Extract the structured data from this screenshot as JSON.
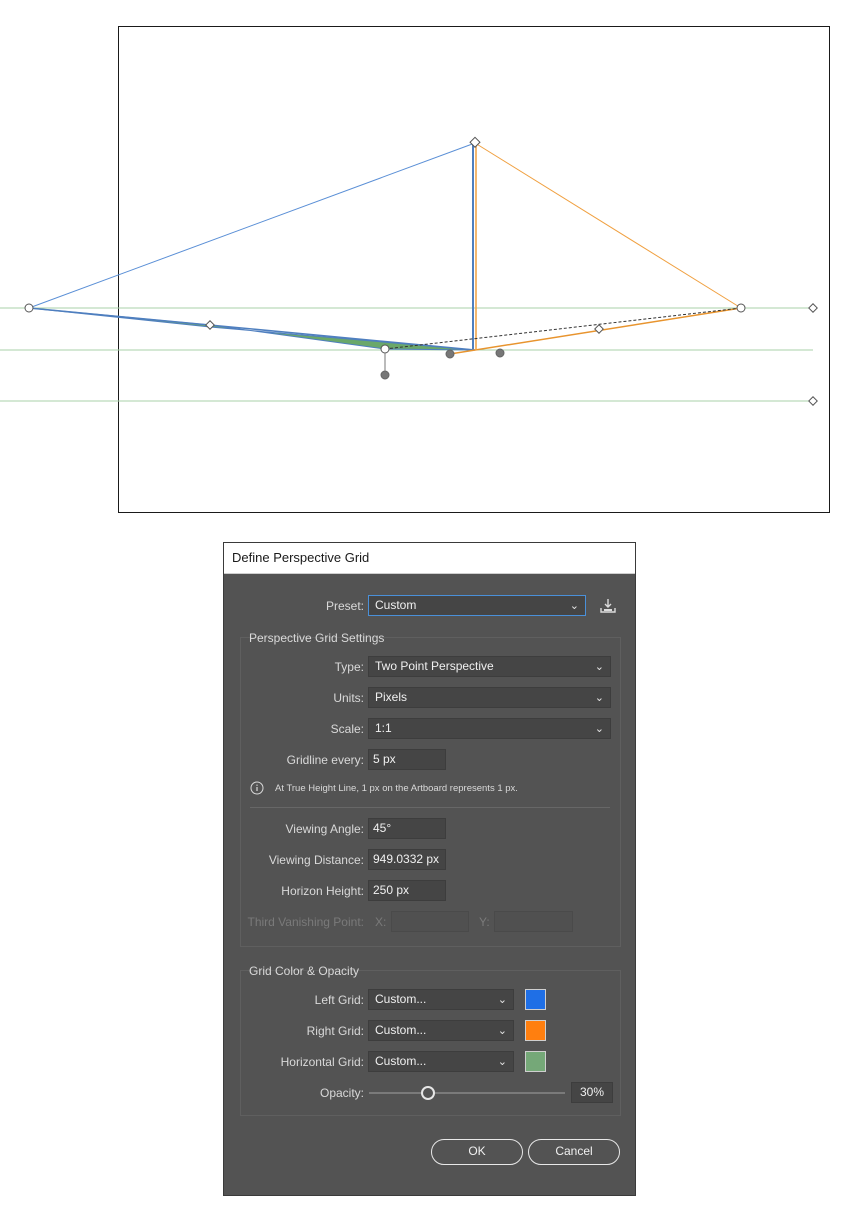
{
  "canvas": {
    "colors": {
      "left": "#5a8fd6",
      "right": "#f0a040",
      "horizon": "#a9d1a9",
      "plane": "#6aa86a"
    }
  },
  "dialog": {
    "title": "Define Perspective Grid",
    "preset": {
      "label": "Preset:",
      "value": "Custom",
      "save_icon": "save-preset-icon"
    },
    "settings": {
      "group_title": "Perspective Grid Settings",
      "type": {
        "label": "Type:",
        "value": "Two Point Perspective"
      },
      "units": {
        "label": "Units:",
        "value": "Pixels"
      },
      "scale": {
        "label": "Scale:",
        "value": "1:1"
      },
      "gridline": {
        "label": "Gridline every:",
        "value": "5 px"
      },
      "info": "At True Height Line, 1 px on the Artboard represents 1 px.",
      "viewing_angle": {
        "label": "Viewing Angle:",
        "value": "45°"
      },
      "viewing_distance": {
        "label": "Viewing Distance:",
        "value": "949.0332 px"
      },
      "horizon_height": {
        "label": "Horizon Height:",
        "value": "250 px"
      },
      "third_vp": {
        "label": "Third Vanishing Point:",
        "x_label": "X:",
        "y_label": "Y:",
        "x_value": "",
        "y_value": ""
      }
    },
    "colors": {
      "group_title": "Grid Color & Opacity",
      "left": {
        "label": "Left Grid:",
        "value": "Custom...",
        "swatch": "#1f6fe6"
      },
      "right": {
        "label": "Right Grid:",
        "value": "Custom...",
        "swatch": "#ff7f0f"
      },
      "horizontal": {
        "label": "Horizontal Grid:",
        "value": "Custom...",
        "swatch": "#75a878"
      },
      "opacity": {
        "label": "Opacity:",
        "value": "30%",
        "fraction": 0.3
      }
    },
    "buttons": {
      "ok": "OK",
      "cancel": "Cancel"
    }
  }
}
